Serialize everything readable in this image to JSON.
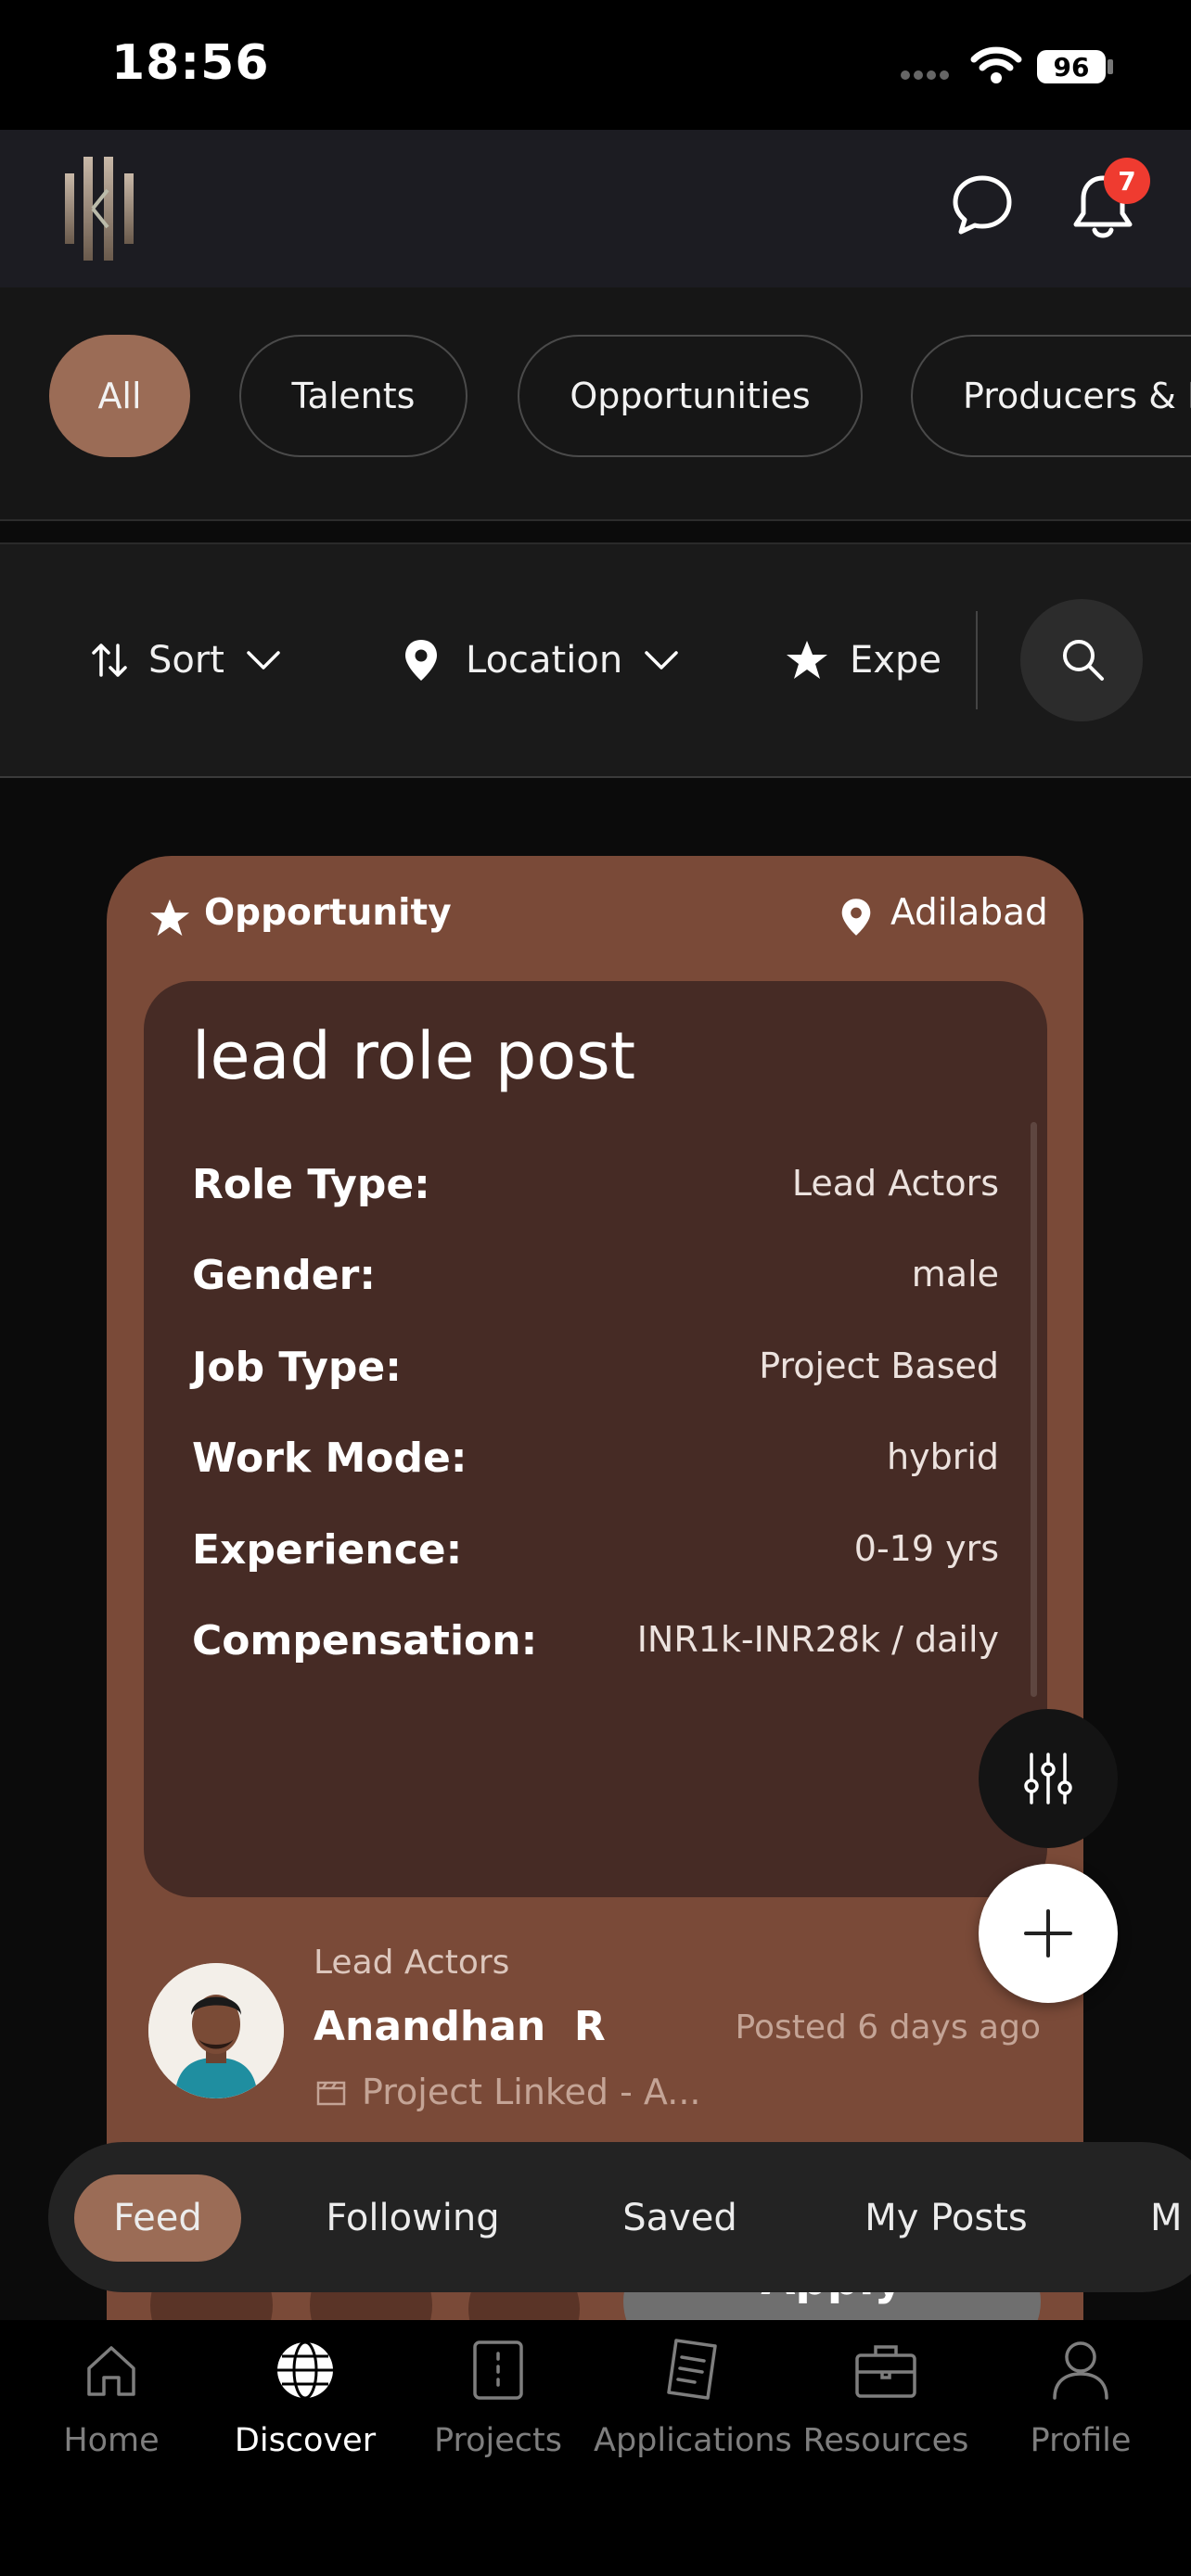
{
  "status_bar": {
    "time": "18:56",
    "battery": "96"
  },
  "header": {
    "notification_count": "7"
  },
  "categories": [
    {
      "label": "All",
      "active": true
    },
    {
      "label": "Talents"
    },
    {
      "label": "Opportunities"
    },
    {
      "label": "Producers & P"
    }
  ],
  "filters": {
    "sort": "Sort",
    "location": "Location",
    "experience": "Expe"
  },
  "card": {
    "type": "Opportunity",
    "location": "Adilabad",
    "title": "lead role post",
    "details": [
      {
        "label": "Role Type:",
        "value": "Lead Actors"
      },
      {
        "label": "Gender:",
        "value": "male"
      },
      {
        "label": "Job Type:",
        "value": "Project Based"
      },
      {
        "label": "Work Mode:",
        "value": "hybrid"
      },
      {
        "label": "Experience:",
        "value": "0-19 yrs"
      },
      {
        "label": "Compensation:",
        "value": "INR1k-INR28k / daily"
      }
    ],
    "poster": {
      "role": "Lead Actors",
      "name": "Anandhan  R",
      "posted": "Posted 6 days ago",
      "project": "Project Linked - A..."
    },
    "apply_label": "Apply"
  },
  "feed_tabs": [
    "Feed",
    "Following",
    "Saved",
    "My Posts",
    "M"
  ],
  "bottom_nav": [
    {
      "label": "Home",
      "icon": "home-icon"
    },
    {
      "label": "Discover",
      "icon": "globe-icon",
      "active": true
    },
    {
      "label": "Projects",
      "icon": "projects-icon"
    },
    {
      "label": "Applications",
      "icon": "applications-icon"
    },
    {
      "label": "Resources",
      "icon": "briefcase-icon"
    },
    {
      "label": "Profile",
      "icon": "user-icon"
    }
  ],
  "colors": {
    "accent": "#9b6c56",
    "card": "#7a4a38",
    "card_inner": "#462b25",
    "badge": "#ef3b30"
  }
}
